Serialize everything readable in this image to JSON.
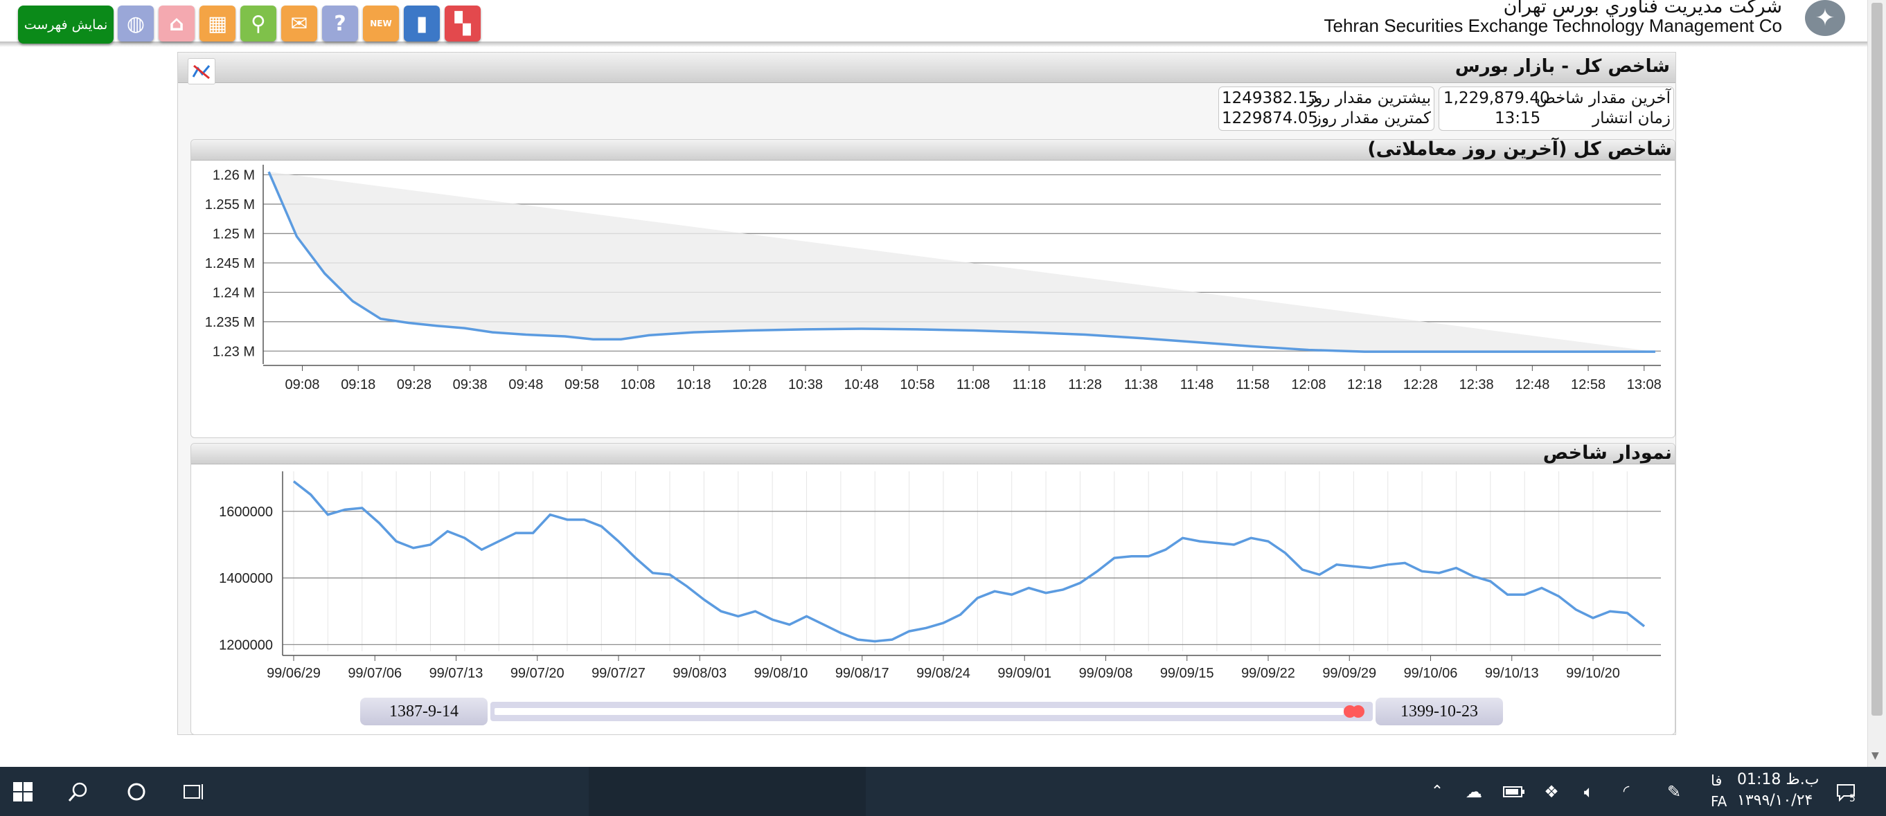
{
  "toolbar": {
    "show_list_label": "نمایش فهرست",
    "buttons": [
      {
        "icon": "globe-icon",
        "color": "#9aa7d8"
      },
      {
        "icon": "home-icon",
        "color": "#f4a9b0"
      },
      {
        "icon": "table-icon",
        "color": "#f4a445"
      },
      {
        "icon": "search-icon",
        "color": "#7fc14a"
      },
      {
        "icon": "message-icon",
        "color": "#f4a445"
      },
      {
        "icon": "help-icon",
        "color": "#9aa7d8"
      },
      {
        "icon": "new-icon",
        "color": "#f4a445",
        "badge": "NEW"
      },
      {
        "icon": "chart-report-icon",
        "color": "#3c78c7"
      },
      {
        "icon": "grid-icon",
        "color": "#e3494d"
      }
    ]
  },
  "header": {
    "company_fa": "شرکت مديريت فناوري بورس تهران",
    "company_en": "Tehran Securities Exchange Technology Management Co"
  },
  "panel": {
    "title": "شاخص کل - بازار بورس",
    "last_value_label": "آخرین مقدار شاخص",
    "last_value": "1,229,879.40",
    "publish_time_label": "زمان انتشار",
    "publish_time": "13:15",
    "day_max_label": "بیشترین مقدار روز",
    "day_max": "1249382.15",
    "day_min_label": "کمترین مقدار روز",
    "day_min": "1229874.05"
  },
  "chart1_title": "شاخص کل (آخرین روز معاملاتی)",
  "chart2_title": "نمودار شاخص",
  "chart_data": [
    {
      "type": "area",
      "title": "شاخص کل (آخرین روز معاملاتی)",
      "ylim": [
        1228500,
        1261000
      ],
      "yticks": [
        1230000,
        1235000,
        1240000,
        1245000,
        1250000,
        1255000,
        1260000
      ],
      "ytick_labels": [
        "1.23 M",
        "1.235 M",
        "1.24 M",
        "1.245 M",
        "1.25 M",
        "1.255 M",
        "1.26 M"
      ],
      "xlim": [
        541,
        791
      ],
      "xticks": [
        548,
        558,
        568,
        578,
        588,
        598,
        608,
        618,
        628,
        638,
        648,
        658,
        668,
        678,
        688,
        698,
        708,
        718,
        728,
        738,
        748,
        758,
        768,
        778,
        788
      ],
      "xtick_labels": [
        "09:08",
        "09:18",
        "09:28",
        "09:38",
        "09:48",
        "09:58",
        "10:08",
        "10:18",
        "10:28",
        "10:38",
        "10:48",
        "10:58",
        "11:08",
        "11:18",
        "11:28",
        "11:38",
        "11:48",
        "11:58",
        "12:08",
        "12:18",
        "12:28",
        "12:38",
        "12:48",
        "12:58",
        "13:08"
      ],
      "grid": true,
      "series": [
        {
          "x": [
            542,
            547,
            552,
            557,
            562,
            567,
            572,
            577,
            582,
            588,
            595,
            600,
            605,
            610,
            618,
            628,
            638,
            648,
            658,
            668,
            678,
            688,
            698,
            708,
            718,
            728,
            738,
            748,
            758,
            768,
            778,
            790
          ],
          "y": [
            1260500,
            1249500,
            1243200,
            1238500,
            1235500,
            1234800,
            1234300,
            1233900,
            1233200,
            1232800,
            1232500,
            1232000,
            1232000,
            1232700,
            1233200,
            1233500,
            1233700,
            1233800,
            1233700,
            1233500,
            1233200,
            1232800,
            1232200,
            1231500,
            1230800,
            1230200,
            1229900,
            1229900,
            1229900,
            1229900,
            1229900,
            1229900
          ]
        }
      ]
    },
    {
      "type": "line",
      "title": "نمودار شاخص",
      "ylim": [
        1180000,
        1720000
      ],
      "yticks": [
        1200000,
        1400000,
        1600000
      ],
      "ytick_labels": [
        "1200000",
        "1400000",
        "1600000"
      ],
      "xlim": [
        -0.5,
        61.5
      ],
      "xticks": [
        0,
        5,
        10,
        15,
        20,
        25,
        30,
        35,
        40,
        45,
        50,
        55
      ],
      "xtick_labels": [
        "99/06/29",
        "99/07/06",
        "99/07/13",
        "99/07/20",
        "99/07/27",
        "99/08/03",
        "99/08/10",
        "99/08/17",
        "99/08/24",
        "99/09/01",
        "99/09/08",
        "99/09/15",
        "99/09/22",
        "99/09/29",
        "99/10/06",
        "99/10/13",
        "99/10/20"
      ],
      "grid": true,
      "series": [
        {
          "y": [
            1690000,
            1650000,
            1590000,
            1605000,
            1610000,
            1565000,
            1510000,
            1490000,
            1500000,
            1540000,
            1520000,
            1485000,
            1510000,
            1535000,
            1535000,
            1590000,
            1575000,
            1575000,
            1555000,
            1510000,
            1460000,
            1415000,
            1410000,
            1375000,
            1335000,
            1300000,
            1285000,
            1300000,
            1275000,
            1260000,
            1285000,
            1260000,
            1235000,
            1215000,
            1210000,
            1215000,
            1240000,
            1250000,
            1265000,
            1290000,
            1340000,
            1360000,
            1350000,
            1370000,
            1355000,
            1365000,
            1385000,
            1420000,
            1460000,
            1465000,
            1465000,
            1485000,
            1520000,
            1510000,
            1505000,
            1500000,
            1520000,
            1510000,
            1475000,
            1425000,
            1410000,
            1440000,
            1435000,
            1430000,
            1440000,
            1445000,
            1420000,
            1415000,
            1430000,
            1405000,
            1390000,
            1350000,
            1350000,
            1370000,
            1345000,
            1305000,
            1280000,
            1300000,
            1295000,
            1255000
          ]
        }
      ]
    }
  ],
  "range": {
    "start": "1387-9-14",
    "end": "1399-10-23"
  },
  "taskbar": {
    "time": "ب.ظ 01:18",
    "date": "۱۳۹۹/۱۰/۲۴",
    "lang_top": "فا",
    "lang_bottom": "FA",
    "notifications": "5"
  }
}
